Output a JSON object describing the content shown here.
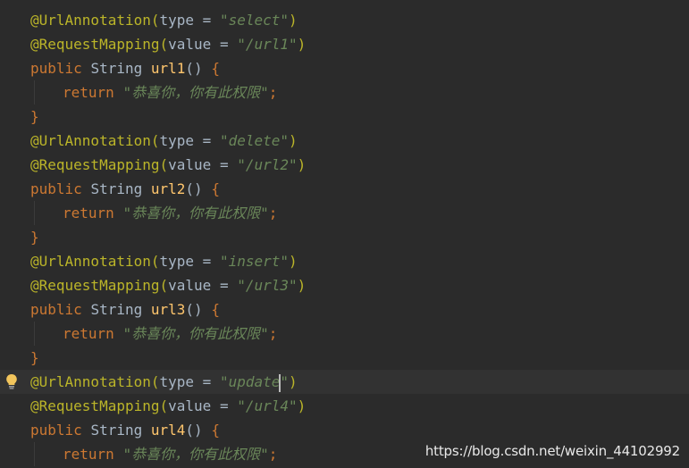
{
  "editor": {
    "theme_colors": {
      "background": "#2b2b2b",
      "current_line": "#323232",
      "annotation": "#bbb529",
      "keyword": "#cc7832",
      "string": "#6a8759",
      "text": "#a9b7c6",
      "method": "#ffc66d"
    },
    "blocks": [
      {
        "annotation_name": "@UrlAnnotation",
        "type_param": "type",
        "type_value": "\"select\"",
        "mapping_name": "@RequestMapping",
        "value_param": "value",
        "url_value": "\"/url1\"",
        "modifier": "public",
        "return_type": "String",
        "method_name": "url1",
        "return_kw": "return",
        "return_value": "\"恭喜你，你有此权限\""
      },
      {
        "annotation_name": "@UrlAnnotation",
        "type_param": "type",
        "type_value": "\"delete\"",
        "mapping_name": "@RequestMapping",
        "value_param": "value",
        "url_value": "\"/url2\"",
        "modifier": "public",
        "return_type": "String",
        "method_name": "url2",
        "return_kw": "return",
        "return_value": "\"恭喜你，你有此权限\""
      },
      {
        "annotation_name": "@UrlAnnotation",
        "type_param": "type",
        "type_value": "\"insert\"",
        "mapping_name": "@RequestMapping",
        "value_param": "value",
        "url_value": "\"/url3\"",
        "modifier": "public",
        "return_type": "String",
        "method_name": "url3",
        "return_kw": "return",
        "return_value": "\"恭喜你，你有此权限\""
      },
      {
        "annotation_name": "@UrlAnnotation",
        "type_param": "type",
        "type_value_before_caret": "\"update",
        "type_value_after_caret": "\"",
        "mapping_name": "@RequestMapping",
        "value_param": "value",
        "url_value": "\"/url4\"",
        "modifier": "public",
        "return_type": "String",
        "method_name": "url4",
        "return_kw": "return",
        "return_value": "\"恭喜你，你有此权限\""
      }
    ],
    "gutter_icon": "lightbulb-icon",
    "watermark": "https://blog.csdn.net/weixin_44102992"
  }
}
